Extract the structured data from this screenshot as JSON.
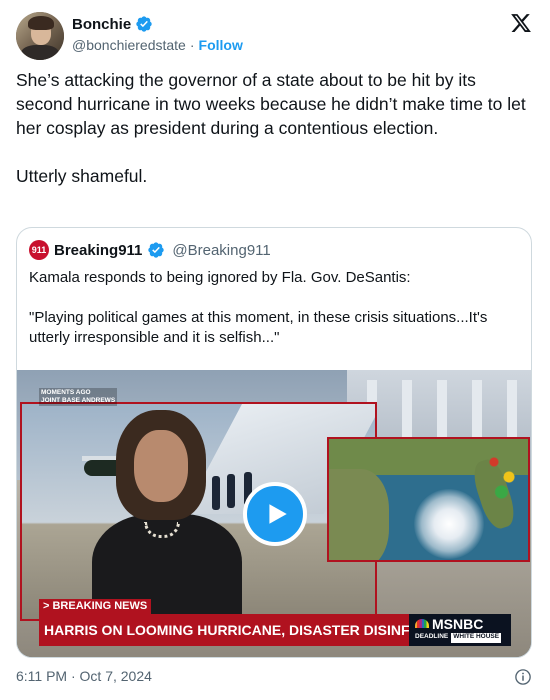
{
  "author": {
    "display_name": "Bonchie",
    "handle": "@bonchieredstate",
    "separator": "·",
    "follow_label": "Follow"
  },
  "tweet": {
    "paragraph_1": "She’s attacking the governor of a state about to be hit by its second hurricane in two weeks because he didn’t make time to let her cosplay as president during a contentious election.",
    "paragraph_2": "Utterly shameful."
  },
  "quoted": {
    "avatar_text": "911",
    "display_name": "Breaking911",
    "handle": "@Breaking911",
    "paragraph_1": "Kamala responds to being ignored by Fla. Gov. DeSantis:",
    "paragraph_2": "\"Playing political games at this moment, in these crisis situations...It's utterly irresponsible and it is selfish...\""
  },
  "video": {
    "location_tag_1": "MOMENTS AGO",
    "location_tag_2": "JOINT BASE ANDREWS",
    "breaking_label": "> BREAKING NEWS",
    "headline": "HARRIS ON LOOMING HURRICANE, DISASTER DISINFORMATION",
    "network": "MSNBC",
    "show_tag_1": "DEADLINE",
    "show_tag_2": "WHITE HOUSE"
  },
  "footer": {
    "timestamp": "6:11 PM · Oct 7, 2024"
  },
  "icons": {
    "verified": "verified-badge-icon",
    "x_logo": "x-logo-icon",
    "play": "play-icon",
    "info": "info-icon"
  },
  "colors": {
    "accent": "#1d9bf0",
    "secondary_text": "#536471",
    "news_red": "#b0121f"
  }
}
